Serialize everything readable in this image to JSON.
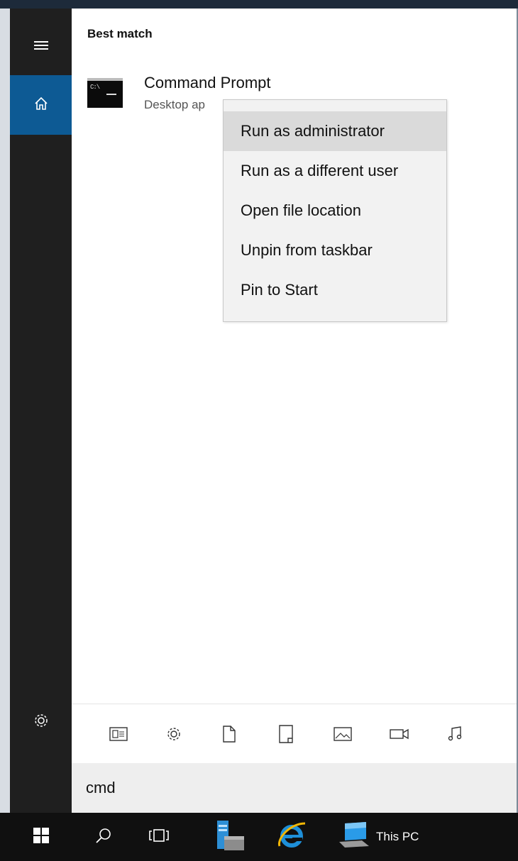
{
  "start_menu": {
    "section_heading": "Best match",
    "result": {
      "title": "Command Prompt",
      "subtitle": "Desktop ap",
      "icon": "command-prompt-icon",
      "icon_text": "C:\\"
    },
    "rail": {
      "top_icons": [
        "hamburger-menu-icon",
        "home-icon"
      ],
      "bottom_icons": [
        "settings-gear-icon"
      ],
      "active_color": "#0d5a94"
    },
    "context_menu": {
      "items": [
        {
          "label": "Run as administrator",
          "highlighted": true
        },
        {
          "label": "Run as a different user",
          "highlighted": false
        },
        {
          "label": "Open file location",
          "highlighted": false
        },
        {
          "label": "Unpin from taskbar",
          "highlighted": false
        },
        {
          "label": "Pin to Start",
          "highlighted": false
        }
      ]
    },
    "filter_icons": [
      "apps-icon",
      "settings-icon",
      "documents-icon",
      "folders-icon",
      "photos-icon",
      "videos-icon",
      "music-icon"
    ],
    "search": {
      "value": "cmd"
    }
  },
  "taskbar": {
    "items": [
      "windows-start-icon",
      "search-icon",
      "task-view-icon",
      "server-manager-icon",
      "internet-explorer-icon",
      "this-pc-icon"
    ],
    "pinned_label": "This PC"
  },
  "colors": {
    "rail_bg": "#1f1f1f",
    "taskbar_bg": "#101010",
    "accent": "#0d5a94",
    "ie_blue": "#1e8fd8"
  }
}
